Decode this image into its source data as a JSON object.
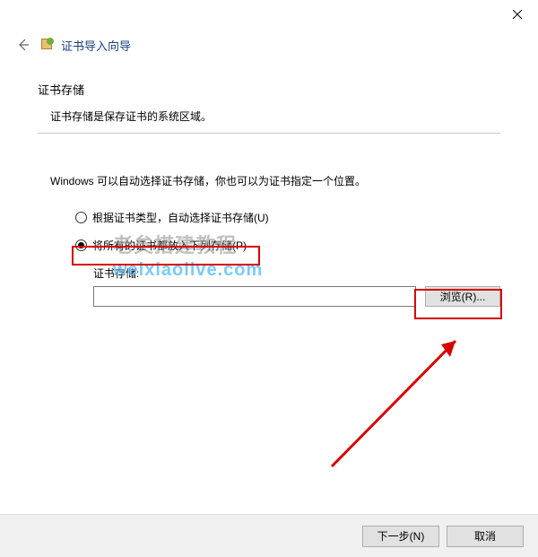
{
  "window": {
    "title": "证书导入向导"
  },
  "section": {
    "heading": "证书存储",
    "description": "证书存储是保存证书的系统区域。"
  },
  "instruction": "Windows 可以自动选择证书存储，你也可以为证书指定一个位置。",
  "radios": {
    "auto": "根据证书类型，自动选择证书存储(U)",
    "manual": "将所有的证书都放入下列存储(P)"
  },
  "store": {
    "label": "证书存储:",
    "value": "",
    "browse": "浏览(R)..."
  },
  "footer": {
    "next": "下一步(N)",
    "cancel": "取消"
  },
  "watermark": {
    "line1": "老矣搭建教程",
    "line2": "weixiaolive.com"
  }
}
